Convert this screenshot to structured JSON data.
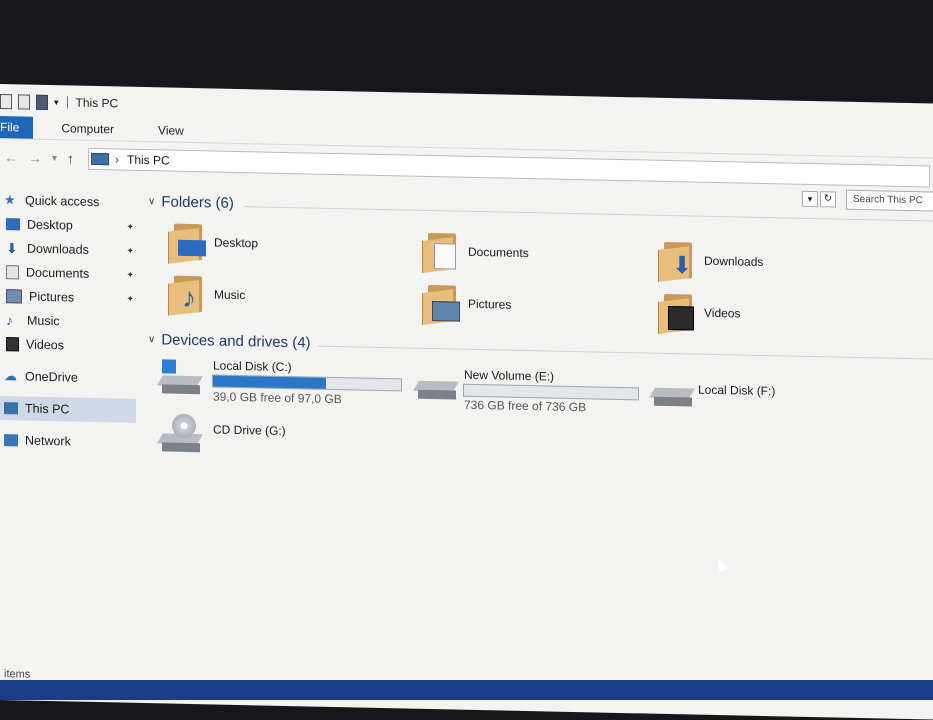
{
  "window": {
    "title": "This PC"
  },
  "ribbon": {
    "tabs": [
      "File",
      "Computer",
      "View"
    ]
  },
  "address": {
    "location": "This PC",
    "search_placeholder": "Search This PC"
  },
  "sidebar": {
    "items": [
      {
        "label": "Quick access",
        "icon": "star-icon"
      },
      {
        "label": "Desktop",
        "icon": "desktop-icon",
        "pinned": true
      },
      {
        "label": "Downloads",
        "icon": "download-arrow-icon",
        "pinned": true
      },
      {
        "label": "Documents",
        "icon": "document-icon",
        "pinned": true
      },
      {
        "label": "Pictures",
        "icon": "picture-icon",
        "pinned": true
      },
      {
        "label": "Music",
        "icon": "music-note-icon"
      },
      {
        "label": "Videos",
        "icon": "film-icon"
      },
      {
        "label": "OneDrive",
        "icon": "cloud-icon"
      },
      {
        "label": "This PC",
        "icon": "computer-icon",
        "selected": true
      },
      {
        "label": "Network",
        "icon": "network-icon"
      }
    ]
  },
  "folders": {
    "header": "Folders (6)",
    "items": [
      {
        "label": "Desktop"
      },
      {
        "label": "Documents"
      },
      {
        "label": "Downloads"
      },
      {
        "label": "Music"
      },
      {
        "label": "Pictures"
      },
      {
        "label": "Videos"
      }
    ]
  },
  "drives": {
    "header": "Devices and drives (4)",
    "items": [
      {
        "label": "Local Disk (C:)",
        "free_text": "39,0 GB free of 97,0 GB",
        "used_fraction": 0.6
      },
      {
        "label": "New Volume (E:)",
        "free_text": "736 GB free of 736 GB",
        "used_fraction": 0.0
      },
      {
        "label": "Local Disk (F:)"
      },
      {
        "label": "CD Drive (G:)"
      }
    ]
  },
  "status": {
    "text": "items"
  },
  "colors": {
    "accent": "#1e66b8",
    "bar_fill": "#2b77c5",
    "selection": "#cfd8e6",
    "taskbar": "#1a3d8a"
  }
}
